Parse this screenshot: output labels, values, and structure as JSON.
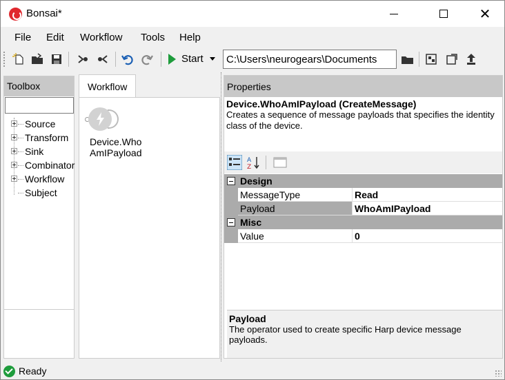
{
  "window": {
    "title": "Bonsai*",
    "controls": [
      "minimize",
      "maximize",
      "close"
    ]
  },
  "menu": [
    "File",
    "Edit",
    "Workflow",
    "Tools",
    "Help"
  ],
  "toolbar": {
    "start_label": "Start",
    "path_value": "C:\\Users\\neurogears\\Documents",
    "icons": [
      "new-file-icon",
      "open-folder-icon",
      "save-icon",
      "group-icon",
      "ungroup-icon",
      "undo-icon",
      "redo-icon",
      "start-icon",
      "browse-folder-icon",
      "package-manager-icon",
      "gallery-icon",
      "upload-icon"
    ]
  },
  "toolbox": {
    "header": "Toolbox",
    "search_value": "",
    "items": [
      "Source",
      "Transform",
      "Sink",
      "Combinator",
      "Workflow",
      "Subject"
    ]
  },
  "workflow": {
    "tab_label": "Workflow",
    "node_label_line1": "Device.Who",
    "node_label_line2": "AmIPayload"
  },
  "properties": {
    "header": "Properties",
    "selected_title": "Device.WhoAmIPayload (CreateMessage)",
    "selected_desc": "Creates a sequence of message payloads that specifies the identity class of the device.",
    "categories": [
      {
        "name": "Design",
        "rows": [
          {
            "name": "MessageType",
            "value": "Read"
          },
          {
            "name": "Payload",
            "value": "WhoAmIPayload"
          }
        ]
      },
      {
        "name": "Misc",
        "rows": [
          {
            "name": "Value",
            "value": "0"
          }
        ]
      }
    ],
    "desc_title": "Payload",
    "desc_text": "The operator used to create specific Harp device message payloads."
  },
  "status": {
    "text": "Ready",
    "color": "#1e9c3c"
  }
}
